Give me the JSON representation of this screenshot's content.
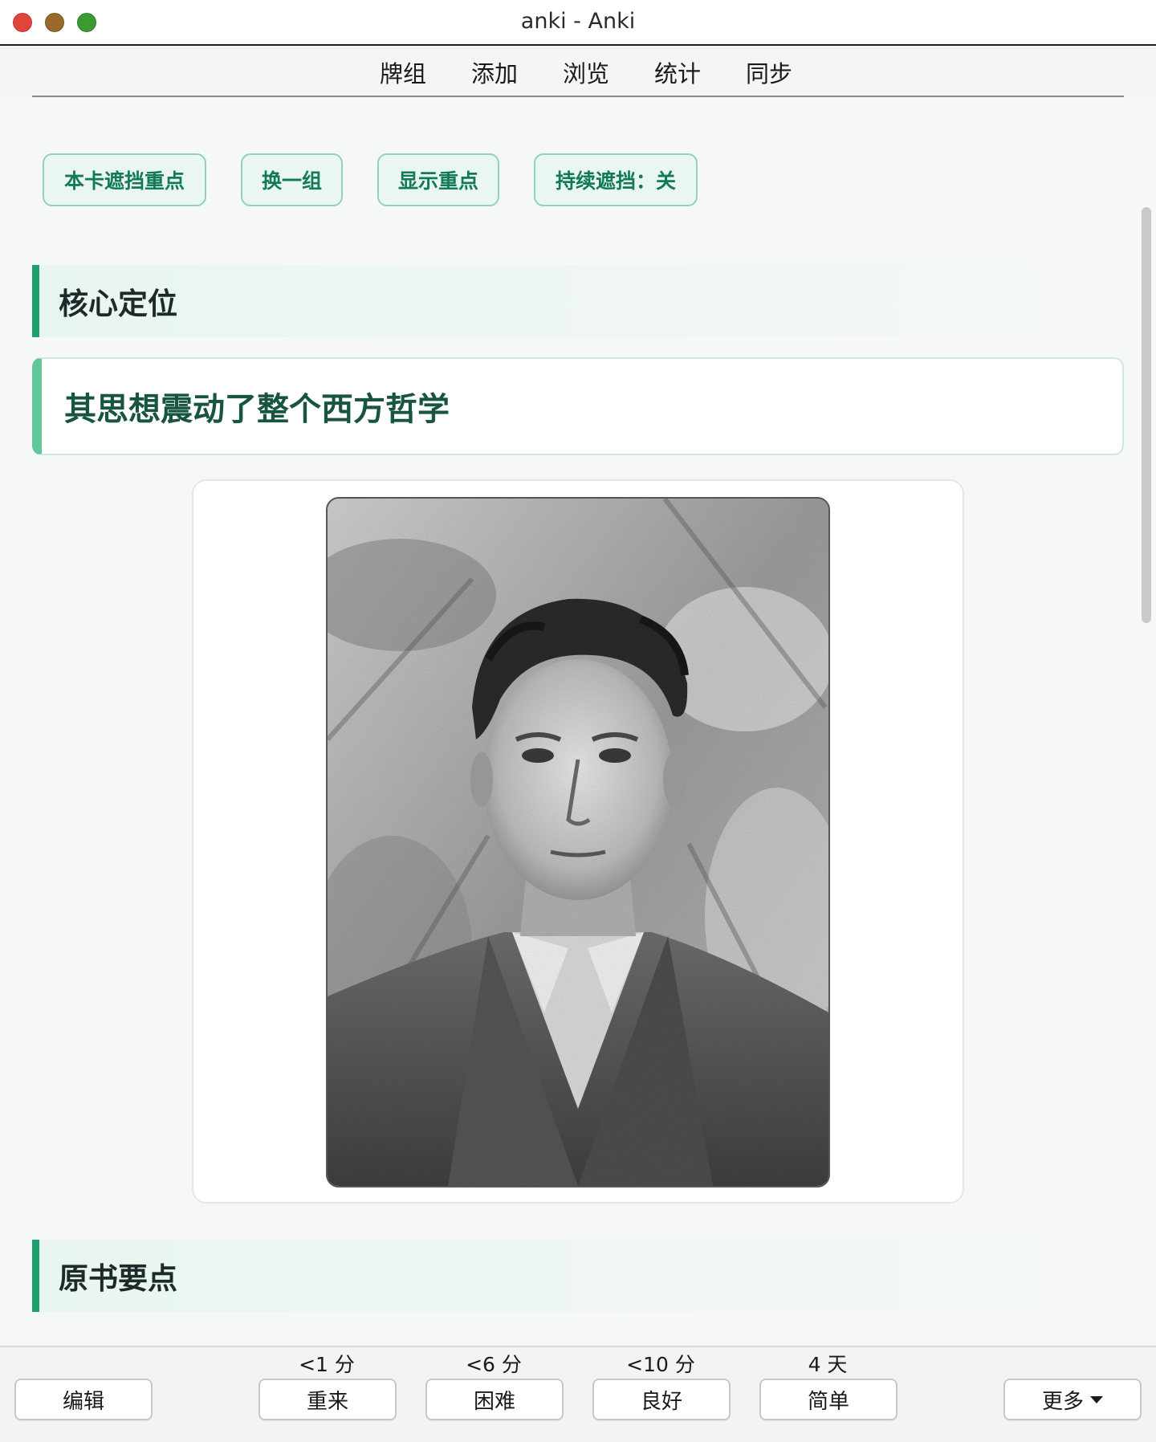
{
  "window": {
    "title": "anki - Anki"
  },
  "topnav": {
    "items": [
      "牌组",
      "添加",
      "浏览",
      "统计",
      "同步"
    ]
  },
  "card": {
    "actions": [
      "本卡遮挡重点",
      "换一组",
      "显示重点",
      "持续遮挡：关"
    ],
    "section1_title": "核心定位",
    "highlight": "其思想震动了整个西方哲学",
    "section2_title": "原书要点",
    "photo_alt": "portrait-photo"
  },
  "bottombar": {
    "edit_label": "编辑",
    "answers": [
      {
        "interval": "<1 分",
        "label": "重来"
      },
      {
        "interval": "<6 分",
        "label": "困难"
      },
      {
        "interval": "<10 分",
        "label": "良好"
      },
      {
        "interval": "4 天",
        "label": "简单"
      }
    ],
    "more_label": "更多"
  },
  "colors": {
    "accent": "#1f9e6e",
    "button_text": "#137a55",
    "button_bg": "#eaf7f1",
    "button_border": "#8fd4b8",
    "highlight_text": "#17553f"
  }
}
